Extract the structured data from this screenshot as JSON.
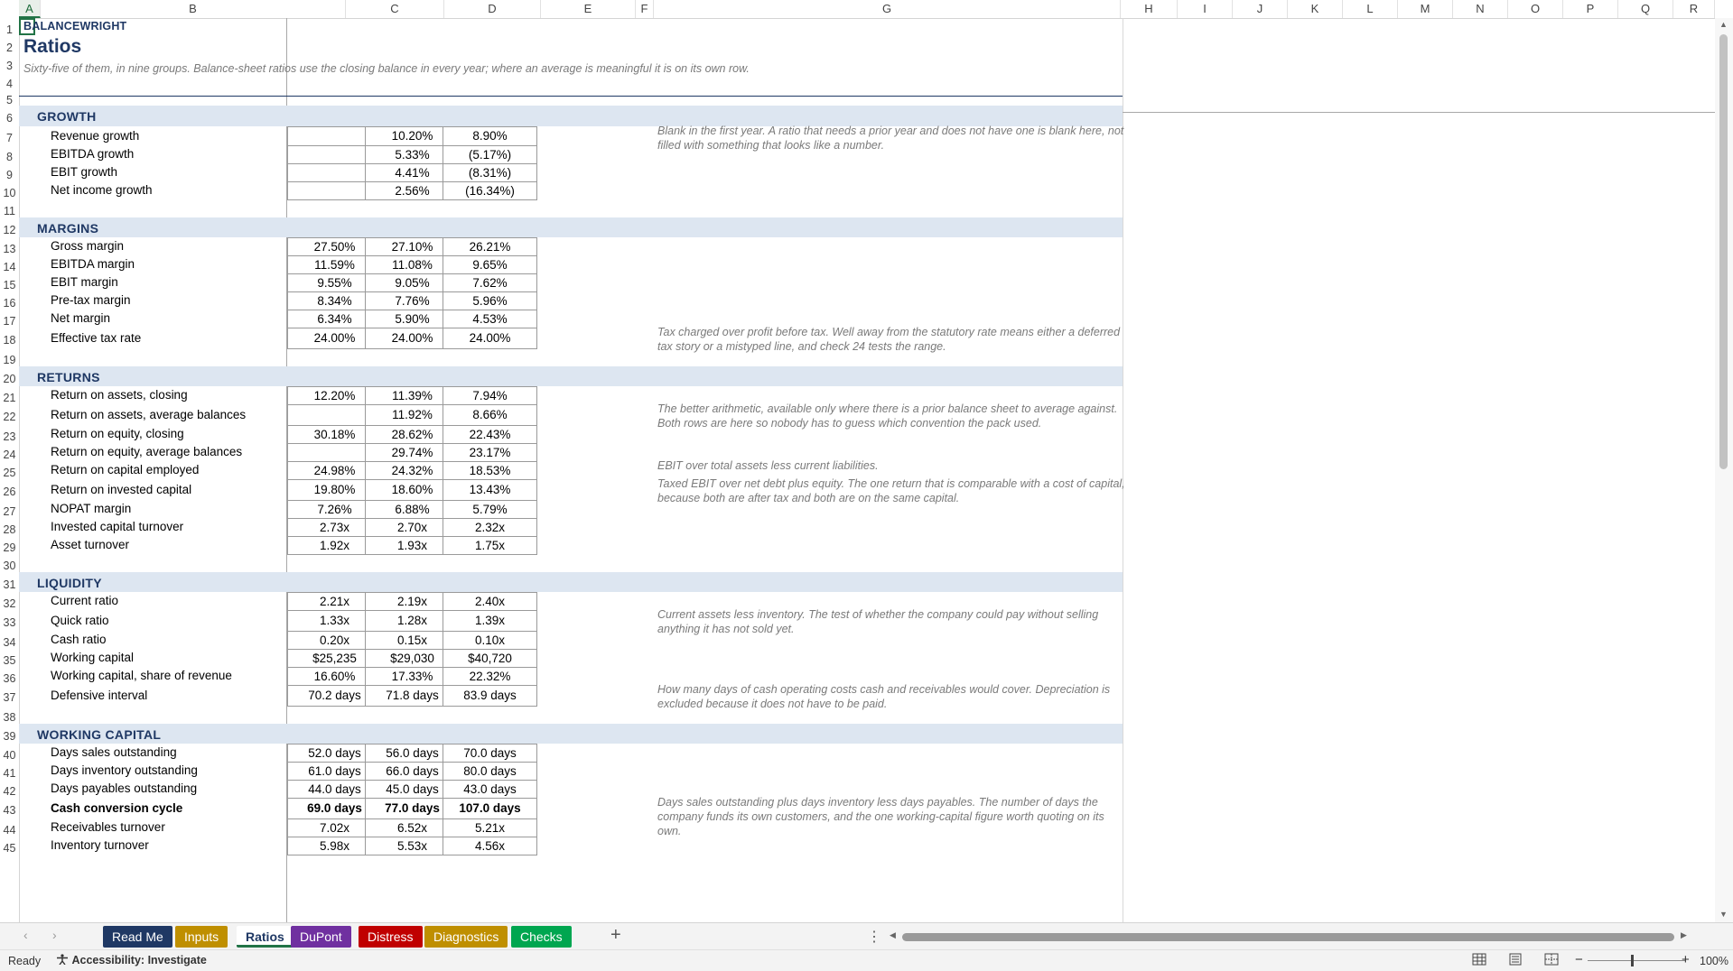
{
  "columns": [
    "A",
    "B",
    "C",
    "D",
    "E",
    "F",
    "G",
    "H",
    "I",
    "J",
    "K",
    "L",
    "M",
    "N",
    "O",
    "P",
    "Q",
    "R"
  ],
  "rows": [
    "1",
    "2",
    "3",
    "4",
    "5",
    "6",
    "7",
    "8",
    "9",
    "10",
    "11",
    "12",
    "13",
    "14",
    "15",
    "16",
    "17",
    "18",
    "19",
    "20",
    "21",
    "22",
    "23",
    "24",
    "25",
    "26",
    "27",
    "28",
    "29",
    "30",
    "31",
    "32",
    "33",
    "34",
    "35",
    "36",
    "37",
    "38",
    "39",
    "40",
    "41",
    "42",
    "43",
    "44",
    "45"
  ],
  "header": {
    "brand": "BALANCEWRIGHT",
    "title": "Ratios",
    "subtitle": "Sixty-five of them, in nine groups. Balance-sheet ratios use the closing balance in every year; where an average is meaningful it is on its own row."
  },
  "sections": [
    {
      "title": "GROWTH",
      "rows": [
        {
          "label": "Revenue growth",
          "values": [
            "",
            "10.20%",
            "8.90%"
          ],
          "note": "Blank in the first year. A ratio that needs a prior year and does not have one is blank here, not filled with something that looks like a number."
        },
        {
          "label": "EBITDA growth",
          "values": [
            "",
            "5.33%",
            "(5.17%)"
          ]
        },
        {
          "label": "EBIT growth",
          "values": [
            "",
            "4.41%",
            "(8.31%)"
          ]
        },
        {
          "label": "Net income growth",
          "values": [
            "",
            "2.56%",
            "(16.34%)"
          ]
        }
      ]
    },
    {
      "title": "MARGINS",
      "rows": [
        {
          "label": "Gross margin",
          "values": [
            "27.50%",
            "27.10%",
            "26.21%"
          ]
        },
        {
          "label": "EBITDA margin",
          "values": [
            "11.59%",
            "11.08%",
            "9.65%"
          ]
        },
        {
          "label": "EBIT margin",
          "values": [
            "9.55%",
            "9.05%",
            "7.62%"
          ]
        },
        {
          "label": "Pre-tax margin",
          "values": [
            "8.34%",
            "7.76%",
            "5.96%"
          ]
        },
        {
          "label": "Net margin",
          "values": [
            "6.34%",
            "5.90%",
            "4.53%"
          ]
        },
        {
          "label": "Effective tax rate",
          "values": [
            "24.00%",
            "24.00%",
            "24.00%"
          ],
          "note": "Tax charged over profit before tax. Well away from the statutory rate means either a deferred tax story or a mistyped line, and check 24 tests the range."
        }
      ]
    },
    {
      "title": "RETURNS",
      "rows": [
        {
          "label": "Return on assets, closing",
          "values": [
            "12.20%",
            "11.39%",
            "7.94%"
          ]
        },
        {
          "label": "Return on assets, average balances",
          "values": [
            "",
            "11.92%",
            "8.66%"
          ],
          "note": "The better arithmetic, available only where there is a prior balance sheet to average against. Both rows are here so nobody has to guess which convention the pack used."
        },
        {
          "label": "Return on equity, closing",
          "values": [
            "30.18%",
            "28.62%",
            "22.43%"
          ]
        },
        {
          "label": "Return on equity, average balances",
          "values": [
            "",
            "29.74%",
            "23.17%"
          ]
        },
        {
          "label": "Return on capital employed",
          "values": [
            "24.98%",
            "24.32%",
            "18.53%"
          ],
          "note": "EBIT over total assets less current liabilities."
        },
        {
          "label": "Return on invested capital",
          "values": [
            "19.80%",
            "18.60%",
            "13.43%"
          ],
          "note": "Taxed EBIT over net debt plus equity. The one return that is comparable with a cost of capital, because both are after tax and both are on the same capital."
        },
        {
          "label": "NOPAT margin",
          "values": [
            "7.26%",
            "6.88%",
            "5.79%"
          ]
        },
        {
          "label": "Invested capital turnover",
          "values": [
            "2.73x",
            "2.70x",
            "2.32x"
          ]
        },
        {
          "label": "Asset turnover",
          "values": [
            "1.92x",
            "1.93x",
            "1.75x"
          ]
        }
      ]
    },
    {
      "title": "LIQUIDITY",
      "rows": [
        {
          "label": "Current ratio",
          "values": [
            "2.21x",
            "2.19x",
            "2.40x"
          ]
        },
        {
          "label": "Quick ratio",
          "values": [
            "1.33x",
            "1.28x",
            "1.39x"
          ],
          "note": "Current assets less inventory. The test of whether the company could pay without selling anything it has not sold yet."
        },
        {
          "label": "Cash ratio",
          "values": [
            "0.20x",
            "0.15x",
            "0.10x"
          ]
        },
        {
          "label": "Working capital",
          "values": [
            "$25,235",
            "$29,030",
            "$40,720"
          ]
        },
        {
          "label": "Working capital, share of revenue",
          "values": [
            "16.60%",
            "17.33%",
            "22.32%"
          ]
        },
        {
          "label": "Defensive interval",
          "values": [
            "70.2 days",
            "71.8 days",
            "83.9 days"
          ],
          "note": "How many days of cash operating costs cash and receivables would cover. Depreciation is excluded because it does not have to be paid."
        }
      ]
    },
    {
      "title": "WORKING CAPITAL",
      "rows": [
        {
          "label": "Days sales outstanding",
          "values": [
            "52.0 days",
            "56.0 days",
            "70.0 days"
          ]
        },
        {
          "label": "Days inventory outstanding",
          "values": [
            "61.0 days",
            "66.0 days",
            "80.0 days"
          ]
        },
        {
          "label": "Days payables outstanding",
          "values": [
            "44.0 days",
            "45.0 days",
            "43.0 days"
          ]
        },
        {
          "label": "Cash conversion cycle",
          "values": [
            "69.0 days",
            "77.0 days",
            "107.0 days"
          ],
          "bold": true,
          "note": "Days sales outstanding plus days inventory less days payables. The number of days the company funds its own customers, and the one working-capital figure worth quoting on its own."
        },
        {
          "label": "Receivables turnover",
          "values": [
            "7.02x",
            "6.52x",
            "5.21x"
          ]
        },
        {
          "label": "Inventory turnover",
          "values": [
            "5.98x",
            "5.53x",
            "4.56x"
          ]
        }
      ]
    }
  ],
  "tabs": [
    {
      "label": "Read Me",
      "color": "#1f3864",
      "text": "#ffffff"
    },
    {
      "label": "Inputs",
      "color": "#bf8f00",
      "text": "#ffffff"
    },
    {
      "label": "Ratios",
      "color": "#ffffff",
      "text": "#1f3864",
      "active": true
    },
    {
      "label": "DuPont",
      "color": "#7030a0",
      "text": "#ffffff"
    },
    {
      "label": "Distress",
      "color": "#c00000",
      "text": "#ffffff"
    },
    {
      "label": "Diagnostics",
      "color": "#bf8f00",
      "text": "#ffffff"
    },
    {
      "label": "Checks",
      "color": "#00a650",
      "text": "#ffffff"
    }
  ],
  "tabbar": {
    "add": "+",
    "more": "⋮",
    "prev": "‹",
    "next": "›"
  },
  "status": {
    "ready": "Ready",
    "accessibility_prefix": "Accessibility:",
    "accessibility_status": "Investigate",
    "zoom": "100%",
    "zoom_minus": "−",
    "zoom_plus": "+"
  },
  "colors": {
    "accent": "#217346",
    "section_band": "#dde6f1",
    "section_text": "#1f3864",
    "note_text": "#7a7a7a"
  }
}
